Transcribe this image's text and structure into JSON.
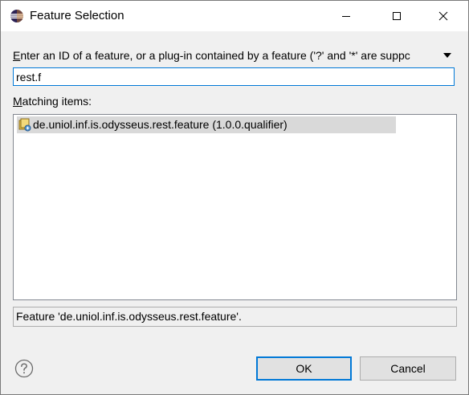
{
  "window": {
    "title": "Feature Selection"
  },
  "dialog": {
    "prompt_label": "Enter an ID of a feature, or a plug-in contained by a feature ('?' and '*' are suppc",
    "prompt_label_accel": "E",
    "prompt_label_rest": "nter an ID of a feature, or a plug-in contained by a feature ('?' and '*' are suppc",
    "filter_value": "rest.f",
    "matching_label_accel": "M",
    "matching_label_rest": "atching items:",
    "results": [
      {
        "label": "de.uniol.inf.is.odysseus.rest.feature (1.0.0.qualifier)",
        "icon": "feature-icon",
        "selected": true
      }
    ],
    "status_text": "Feature 'de.uniol.inf.is.odysseus.rest.feature'.",
    "ok_label": "OK",
    "cancel_label": "Cancel"
  },
  "colors": {
    "focus_border": "#0078d7",
    "selection_bg": "#d9d9d9",
    "dialog_bg": "#f0f0f0"
  }
}
